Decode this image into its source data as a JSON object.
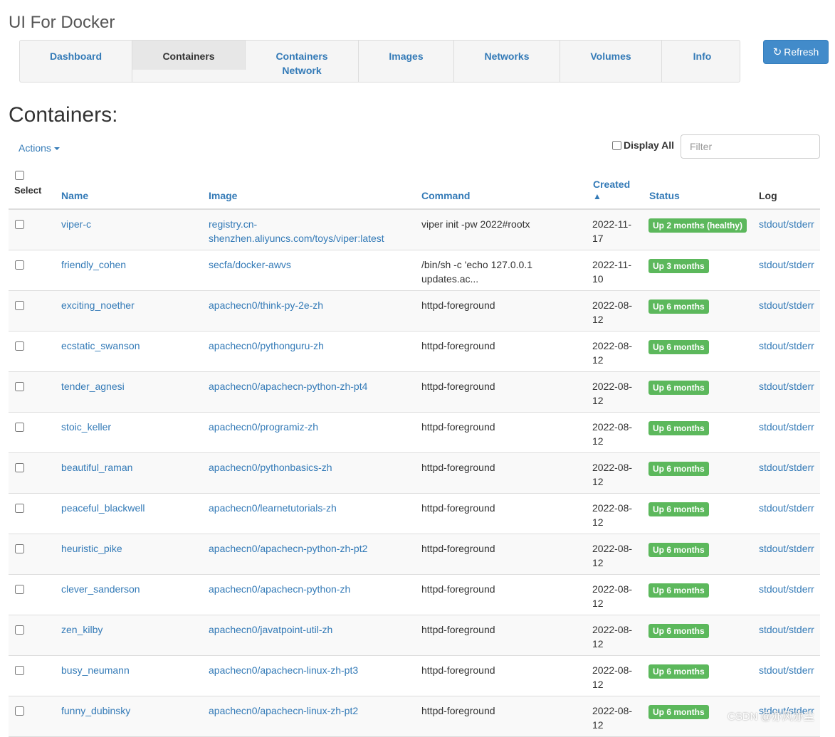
{
  "app": {
    "title": "UI For Docker"
  },
  "nav": {
    "items": [
      {
        "label": "Dashboard"
      },
      {
        "label": "Containers"
      },
      {
        "label": "Containers Network"
      },
      {
        "label": "Images"
      },
      {
        "label": "Networks"
      },
      {
        "label": "Volumes"
      },
      {
        "label": "Info"
      }
    ],
    "active": "Containers"
  },
  "refresh": {
    "label": "Refresh",
    "icon": "refresh-icon"
  },
  "page": {
    "title": "Containers:"
  },
  "toolbar": {
    "actions_label": "Actions",
    "display_all_label": "Display All",
    "filter_placeholder": "Filter"
  },
  "table": {
    "headers": {
      "select": "Select",
      "name": "Name",
      "image": "Image",
      "command": "Command",
      "created": "Created",
      "status": "Status",
      "log": "Log"
    },
    "sort": {
      "column": "Created",
      "direction": "ascending"
    },
    "rows": [
      {
        "name": "viper-c",
        "image": "registry.cn-shenzhen.aliyuncs.com/toys/viper:latest",
        "command": "viper init -pw 2022#rootx",
        "created": "2022-11-17",
        "status": "Up 2 months (healthy)",
        "log": "stdout/stderr"
      },
      {
        "name": "friendly_cohen",
        "image": "secfa/docker-awvs",
        "command": "/bin/sh -c 'echo 127.0.0.1 updates.ac...",
        "created": "2022-11-10",
        "status": "Up 3 months",
        "log": "stdout/stderr"
      },
      {
        "name": "exciting_noether",
        "image": "apachecn0/think-py-2e-zh",
        "command": "httpd-foreground",
        "created": "2022-08-12",
        "status": "Up 6 months",
        "log": "stdout/stderr"
      },
      {
        "name": "ecstatic_swanson",
        "image": "apachecn0/pythonguru-zh",
        "command": "httpd-foreground",
        "created": "2022-08-12",
        "status": "Up 6 months",
        "log": "stdout/stderr"
      },
      {
        "name": "tender_agnesi",
        "image": "apachecn0/apachecn-python-zh-pt4",
        "command": "httpd-foreground",
        "created": "2022-08-12",
        "status": "Up 6 months",
        "log": "stdout/stderr"
      },
      {
        "name": "stoic_keller",
        "image": "apachecn0/programiz-zh",
        "command": "httpd-foreground",
        "created": "2022-08-12",
        "status": "Up 6 months",
        "log": "stdout/stderr"
      },
      {
        "name": "beautiful_raman",
        "image": "apachecn0/pythonbasics-zh",
        "command": "httpd-foreground",
        "created": "2022-08-12",
        "status": "Up 6 months",
        "log": "stdout/stderr"
      },
      {
        "name": "peaceful_blackwell",
        "image": "apachecn0/learnetutorials-zh",
        "command": "httpd-foreground",
        "created": "2022-08-12",
        "status": "Up 6 months",
        "log": "stdout/stderr"
      },
      {
        "name": "heuristic_pike",
        "image": "apachecn0/apachecn-python-zh-pt2",
        "command": "httpd-foreground",
        "created": "2022-08-12",
        "status": "Up 6 months",
        "log": "stdout/stderr"
      },
      {
        "name": "clever_sanderson",
        "image": "apachecn0/apachecn-python-zh",
        "command": "httpd-foreground",
        "created": "2022-08-12",
        "status": "Up 6 months",
        "log": "stdout/stderr"
      },
      {
        "name": "zen_kilby",
        "image": "apachecn0/javatpoint-util-zh",
        "command": "httpd-foreground",
        "created": "2022-08-12",
        "status": "Up 6 months",
        "log": "stdout/stderr"
      },
      {
        "name": "busy_neumann",
        "image": "apachecn0/apachecn-linux-zh-pt3",
        "command": "httpd-foreground",
        "created": "2022-08-12",
        "status": "Up 6 months",
        "log": "stdout/stderr"
      },
      {
        "name": "funny_dubinsky",
        "image": "apachecn0/apachecn-linux-zh-pt2",
        "command": "httpd-foreground",
        "created": "2022-08-12",
        "status": "Up 6 months",
        "log": "stdout/stderr"
      }
    ]
  },
  "watermark": {
    "text": "CSDN @亦风亦尘"
  },
  "colors": {
    "link": "#337ab7",
    "status_badge": "#5cb85c",
    "refresh_button": "#428bca"
  }
}
